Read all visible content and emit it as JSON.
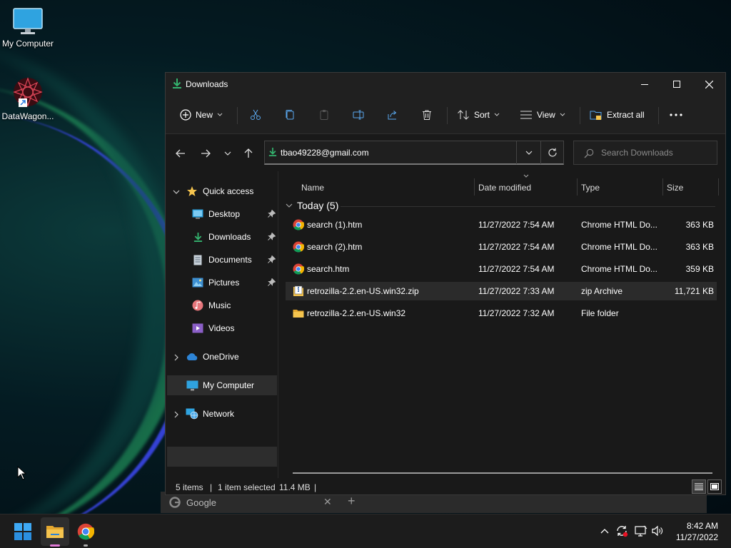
{
  "desktop": {
    "icons": [
      {
        "label": "My Computer"
      },
      {
        "label": "DataWagon..."
      }
    ]
  },
  "window": {
    "title": "Downloads",
    "toolbar": {
      "new_label": "New",
      "sort_label": "Sort",
      "view_label": "View",
      "extract_label": "Extract all"
    },
    "address": {
      "value": "tbao49228@gmail.com"
    },
    "search": {
      "placeholder": "Search Downloads"
    }
  },
  "sidebar": {
    "quick_access": "Quick access",
    "items": [
      {
        "label": "Desktop",
        "pinned": true
      },
      {
        "label": "Downloads",
        "pinned": true
      },
      {
        "label": "Documents",
        "pinned": true
      },
      {
        "label": "Pictures",
        "pinned": true
      },
      {
        "label": "Music",
        "pinned": false
      },
      {
        "label": "Videos",
        "pinned": false
      }
    ],
    "onedrive": "OneDrive",
    "my_computer": "My Computer",
    "network": "Network"
  },
  "filelist": {
    "columns": [
      "Name",
      "Date modified",
      "Type",
      "Size"
    ],
    "group": "Today (5)",
    "rows": [
      {
        "name": "search (1).htm",
        "date": "11/27/2022 7:54 AM",
        "type": "Chrome HTML Do...",
        "size": "363 KB",
        "icon": "chrome-icon"
      },
      {
        "name": "search (2).htm",
        "date": "11/27/2022 7:54 AM",
        "type": "Chrome HTML Do...",
        "size": "363 KB",
        "icon": "chrome-icon"
      },
      {
        "name": "search.htm",
        "date": "11/27/2022 7:54 AM",
        "type": "Chrome HTML Do...",
        "size": "359 KB",
        "icon": "chrome-icon"
      },
      {
        "name": "retrozilla-2.2.en-US.win32.zip",
        "date": "11/27/2022 7:33 AM",
        "type": "zip Archive",
        "size": "11,721 KB",
        "icon": "zip-icon"
      },
      {
        "name": "retrozilla-2.2.en-US.win32",
        "date": "11/27/2022 7:32 AM",
        "type": "File folder",
        "size": "",
        "icon": "folder-icon"
      }
    ]
  },
  "status": {
    "items": "5 items",
    "selected": "1 item selected",
    "size": "11.4 MB"
  },
  "chrome_tab": {
    "title": "Google"
  },
  "taskbar": {
    "time": "8:42 AM",
    "date": "11/27/2022"
  },
  "colors": {
    "accent": "#1e7fd6",
    "download_green": "#34b36e",
    "folder_yellow": "#f5c44e"
  }
}
